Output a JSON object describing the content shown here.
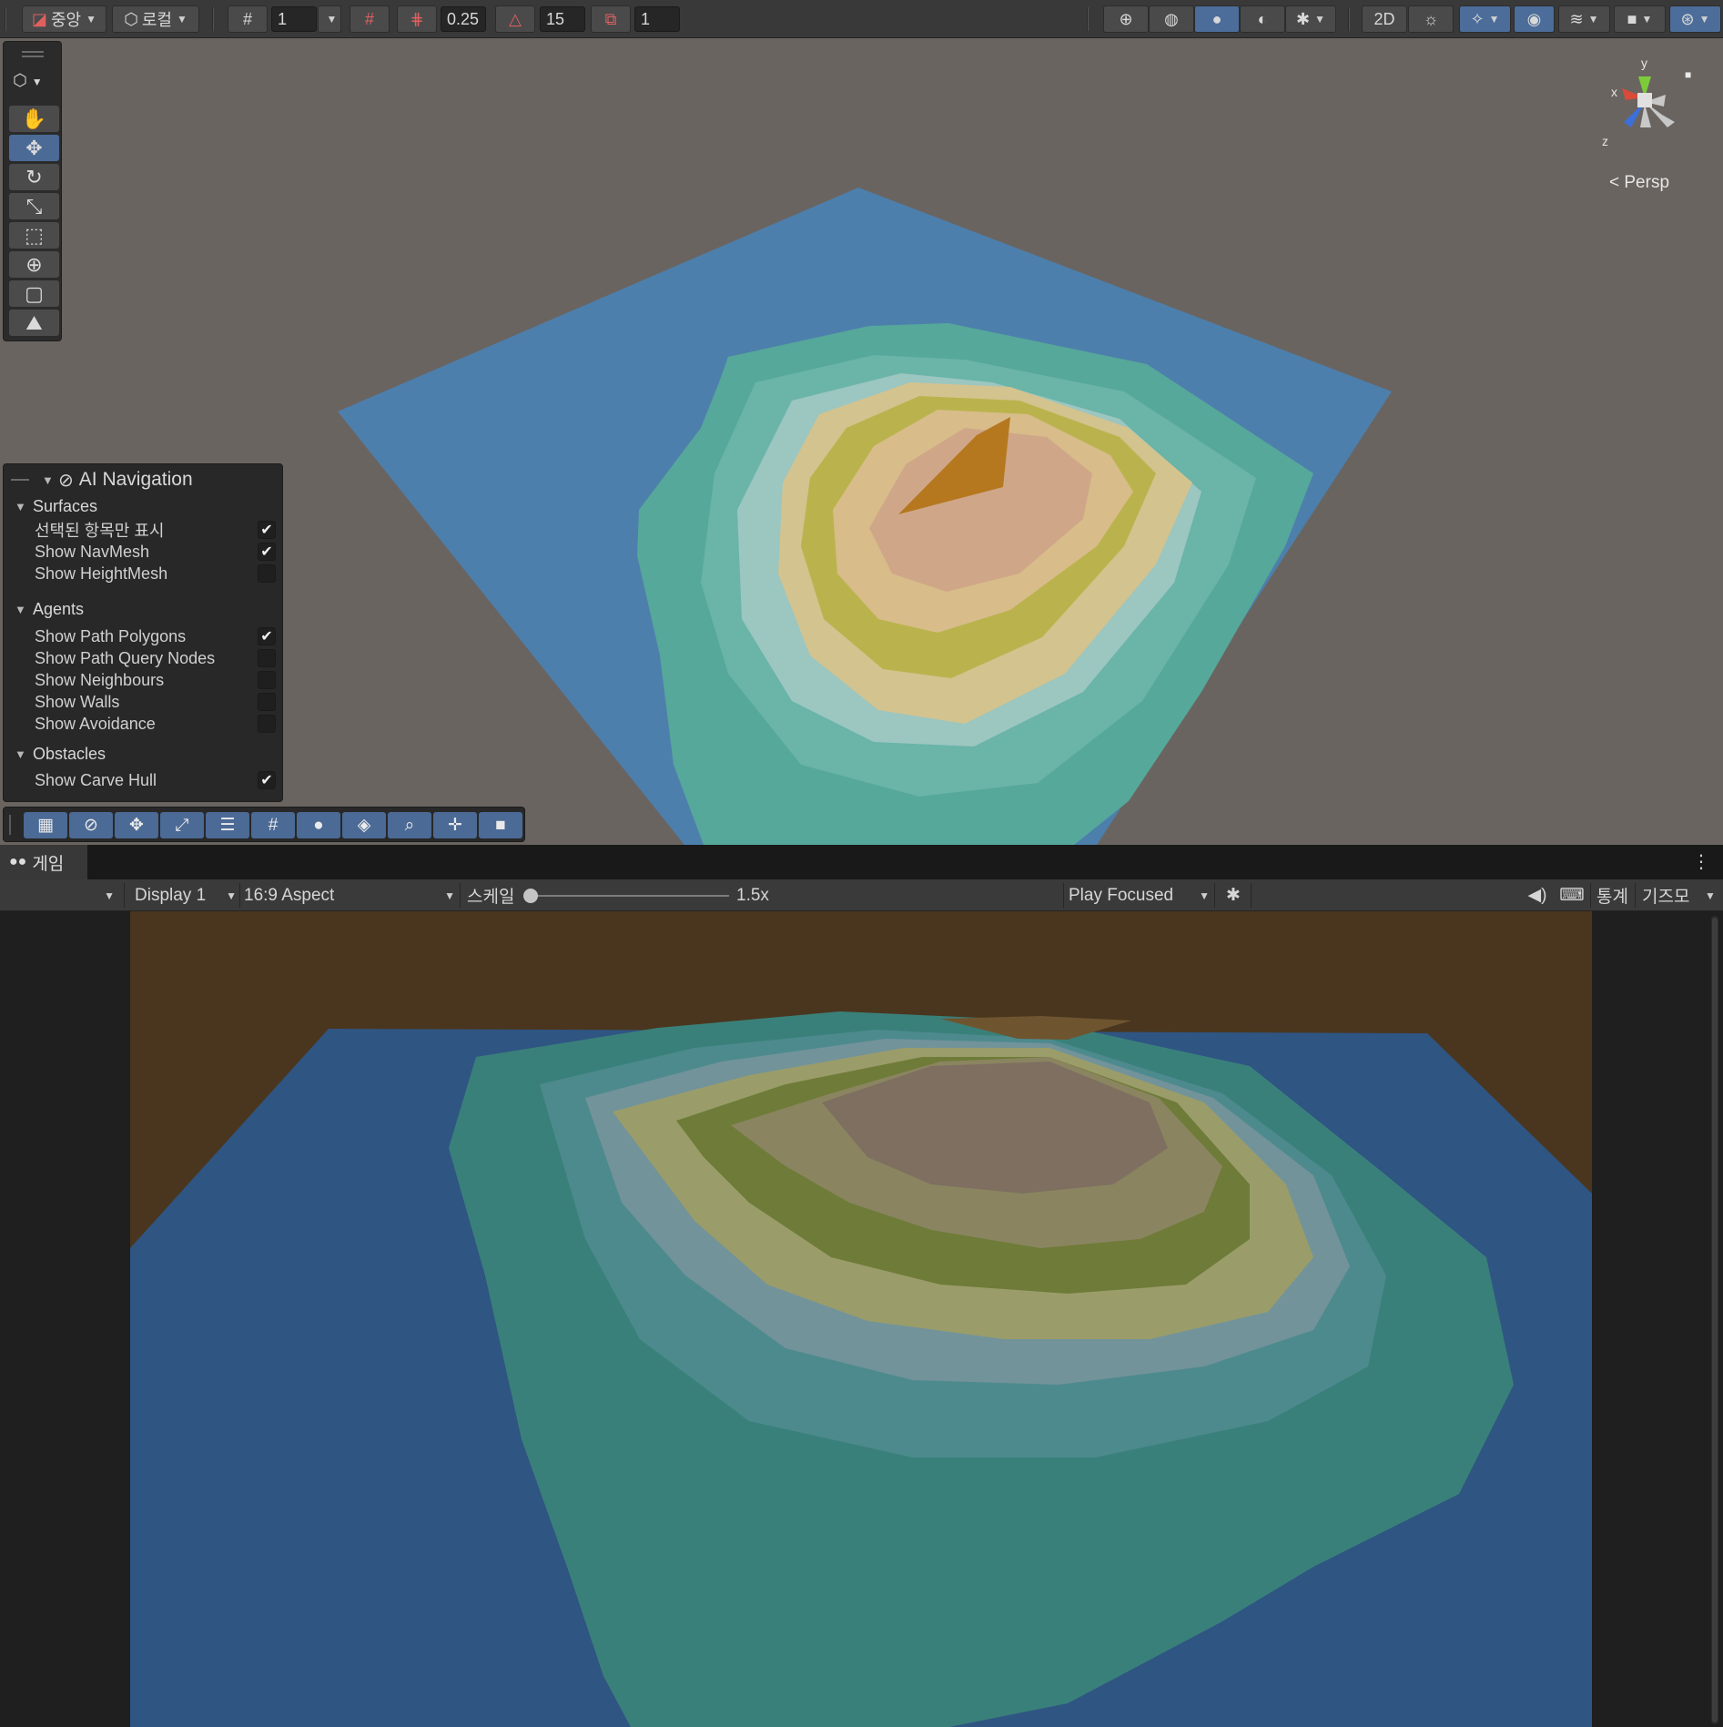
{
  "scene_toolbar": {
    "pivot_label": "중앙",
    "space_label": "로컬",
    "grid_size_value": "1",
    "snap_increment_value": "0.25",
    "rotation_snap_value": "15",
    "scale_snap_value": "1"
  },
  "scene_view": {
    "projection_label": "< Persp",
    "gizmo_axes": {
      "x": "x",
      "y": "y",
      "z": "z"
    }
  },
  "ai_navigation": {
    "title": "AI Navigation",
    "sections": [
      {
        "label": "Surfaces",
        "options": [
          {
            "label": "선택된 항목만 표시",
            "checked": true
          },
          {
            "label": "Show NavMesh",
            "checked": true
          },
          {
            "label": "Show HeightMesh",
            "checked": false
          }
        ]
      },
      {
        "label": "Agents",
        "options": [
          {
            "label": "Show Path Polygons",
            "checked": true
          },
          {
            "label": "Show Path Query Nodes",
            "checked": false
          },
          {
            "label": "Show Neighbours",
            "checked": false
          },
          {
            "label": "Show Walls",
            "checked": false
          },
          {
            "label": "Show Avoidance",
            "checked": false
          }
        ]
      },
      {
        "label": "Obstacles",
        "options": [
          {
            "label": "Show Carve Hull",
            "checked": true
          }
        ]
      }
    ]
  },
  "game_view": {
    "tab_label": "게임",
    "display_label": "Display 1",
    "aspect_label": "16:9 Aspect",
    "scale_label": "스케일",
    "scale_value": "1.5x",
    "scale_slider_fraction": 0.0,
    "play_mode_label": "Play Focused",
    "stats_label": "통계",
    "gizmos_label": "기즈모"
  },
  "colors": {
    "scene_background": "#6a6460",
    "game_sky": "#4a361e",
    "navmesh_blue": "#4d80ad",
    "active_button": "#4c6d9a"
  }
}
